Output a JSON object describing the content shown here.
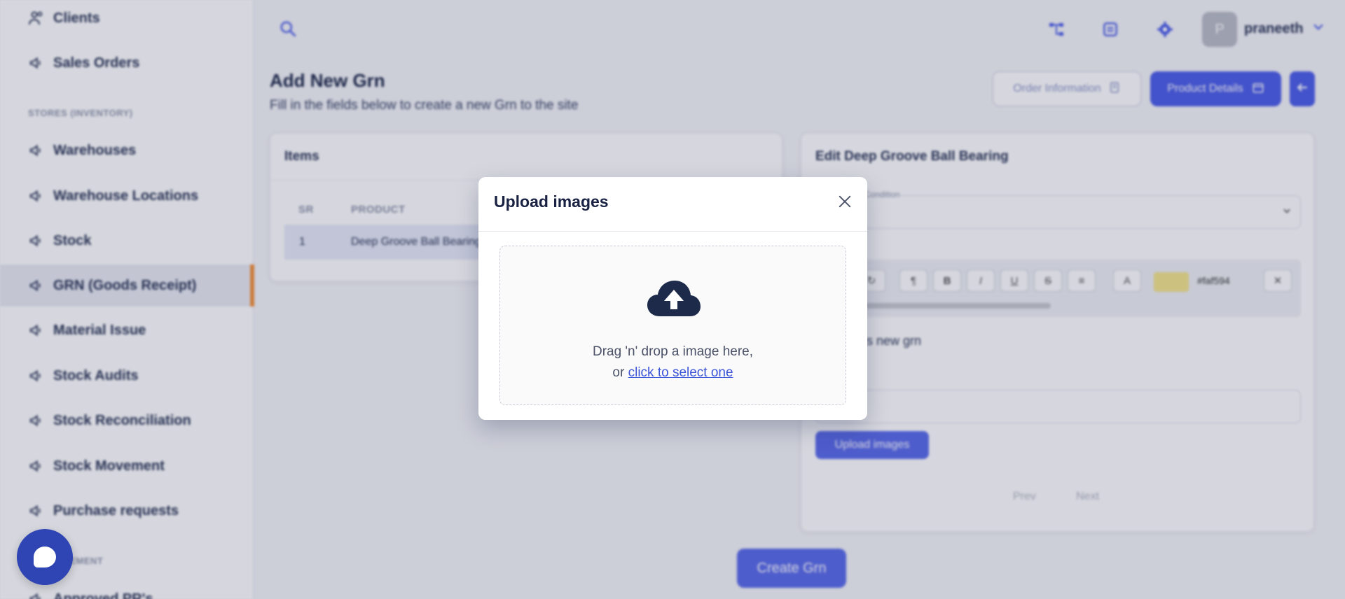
{
  "sidebar": {
    "items": [
      {
        "label": "Clients",
        "icon": "clients-icon"
      },
      {
        "label": "Sales Orders",
        "icon": "megaphone-icon"
      },
      {
        "label": "Warehouses",
        "icon": "megaphone-icon"
      },
      {
        "label": "Warehouse Locations",
        "icon": "megaphone-icon"
      },
      {
        "label": "Stock",
        "icon": "megaphone-icon"
      },
      {
        "label": "GRN (Goods Receipt)",
        "icon": "megaphone-icon",
        "active": true
      },
      {
        "label": "Material Issue",
        "icon": "megaphone-icon"
      },
      {
        "label": "Stock Audits",
        "icon": "megaphone-icon"
      },
      {
        "label": "Stock Reconciliation",
        "icon": "megaphone-icon"
      },
      {
        "label": "Stock Movement",
        "icon": "megaphone-icon"
      },
      {
        "label": "Purchase requests",
        "icon": "megaphone-icon"
      },
      {
        "label": "Approved PR's",
        "icon": "megaphone-icon"
      }
    ],
    "section_inventory": "STORES (INVENTORY)",
    "section_procurement": "PROCUREMENT"
  },
  "header": {
    "username": "praneeth",
    "avatar_initial": "P"
  },
  "page": {
    "title": "Add New Grn",
    "subtitle": "Fill in the fields below to create a new Grn to the site",
    "order_info_label": "Order Information",
    "product_details_label": "Product Details"
  },
  "items_card": {
    "title": "Items",
    "columns": [
      "SR",
      "PRODUCT"
    ],
    "rows": [
      {
        "sr": "1",
        "product": "Deep Groove Ball Bearing"
      }
    ]
  },
  "edit_card": {
    "title": "Edit Deep Groove Ball Bearing",
    "condition_label": "Condition",
    "color_value": "#faf594",
    "editor_text": "This is new grn",
    "upload_label": "Upload images",
    "prev_label": "Prev",
    "next_label": "Next"
  },
  "create_label": "Create Grn",
  "modal": {
    "title": "Upload images",
    "drop_text": "Drag 'n' drop a image here,",
    "or_text": "or",
    "select_link": "click to select one"
  },
  "colors": {
    "primary": "#4c5ee8",
    "active_marker": "#f2903a",
    "link": "#3b54d8",
    "cloud": "#1e2a4a"
  }
}
